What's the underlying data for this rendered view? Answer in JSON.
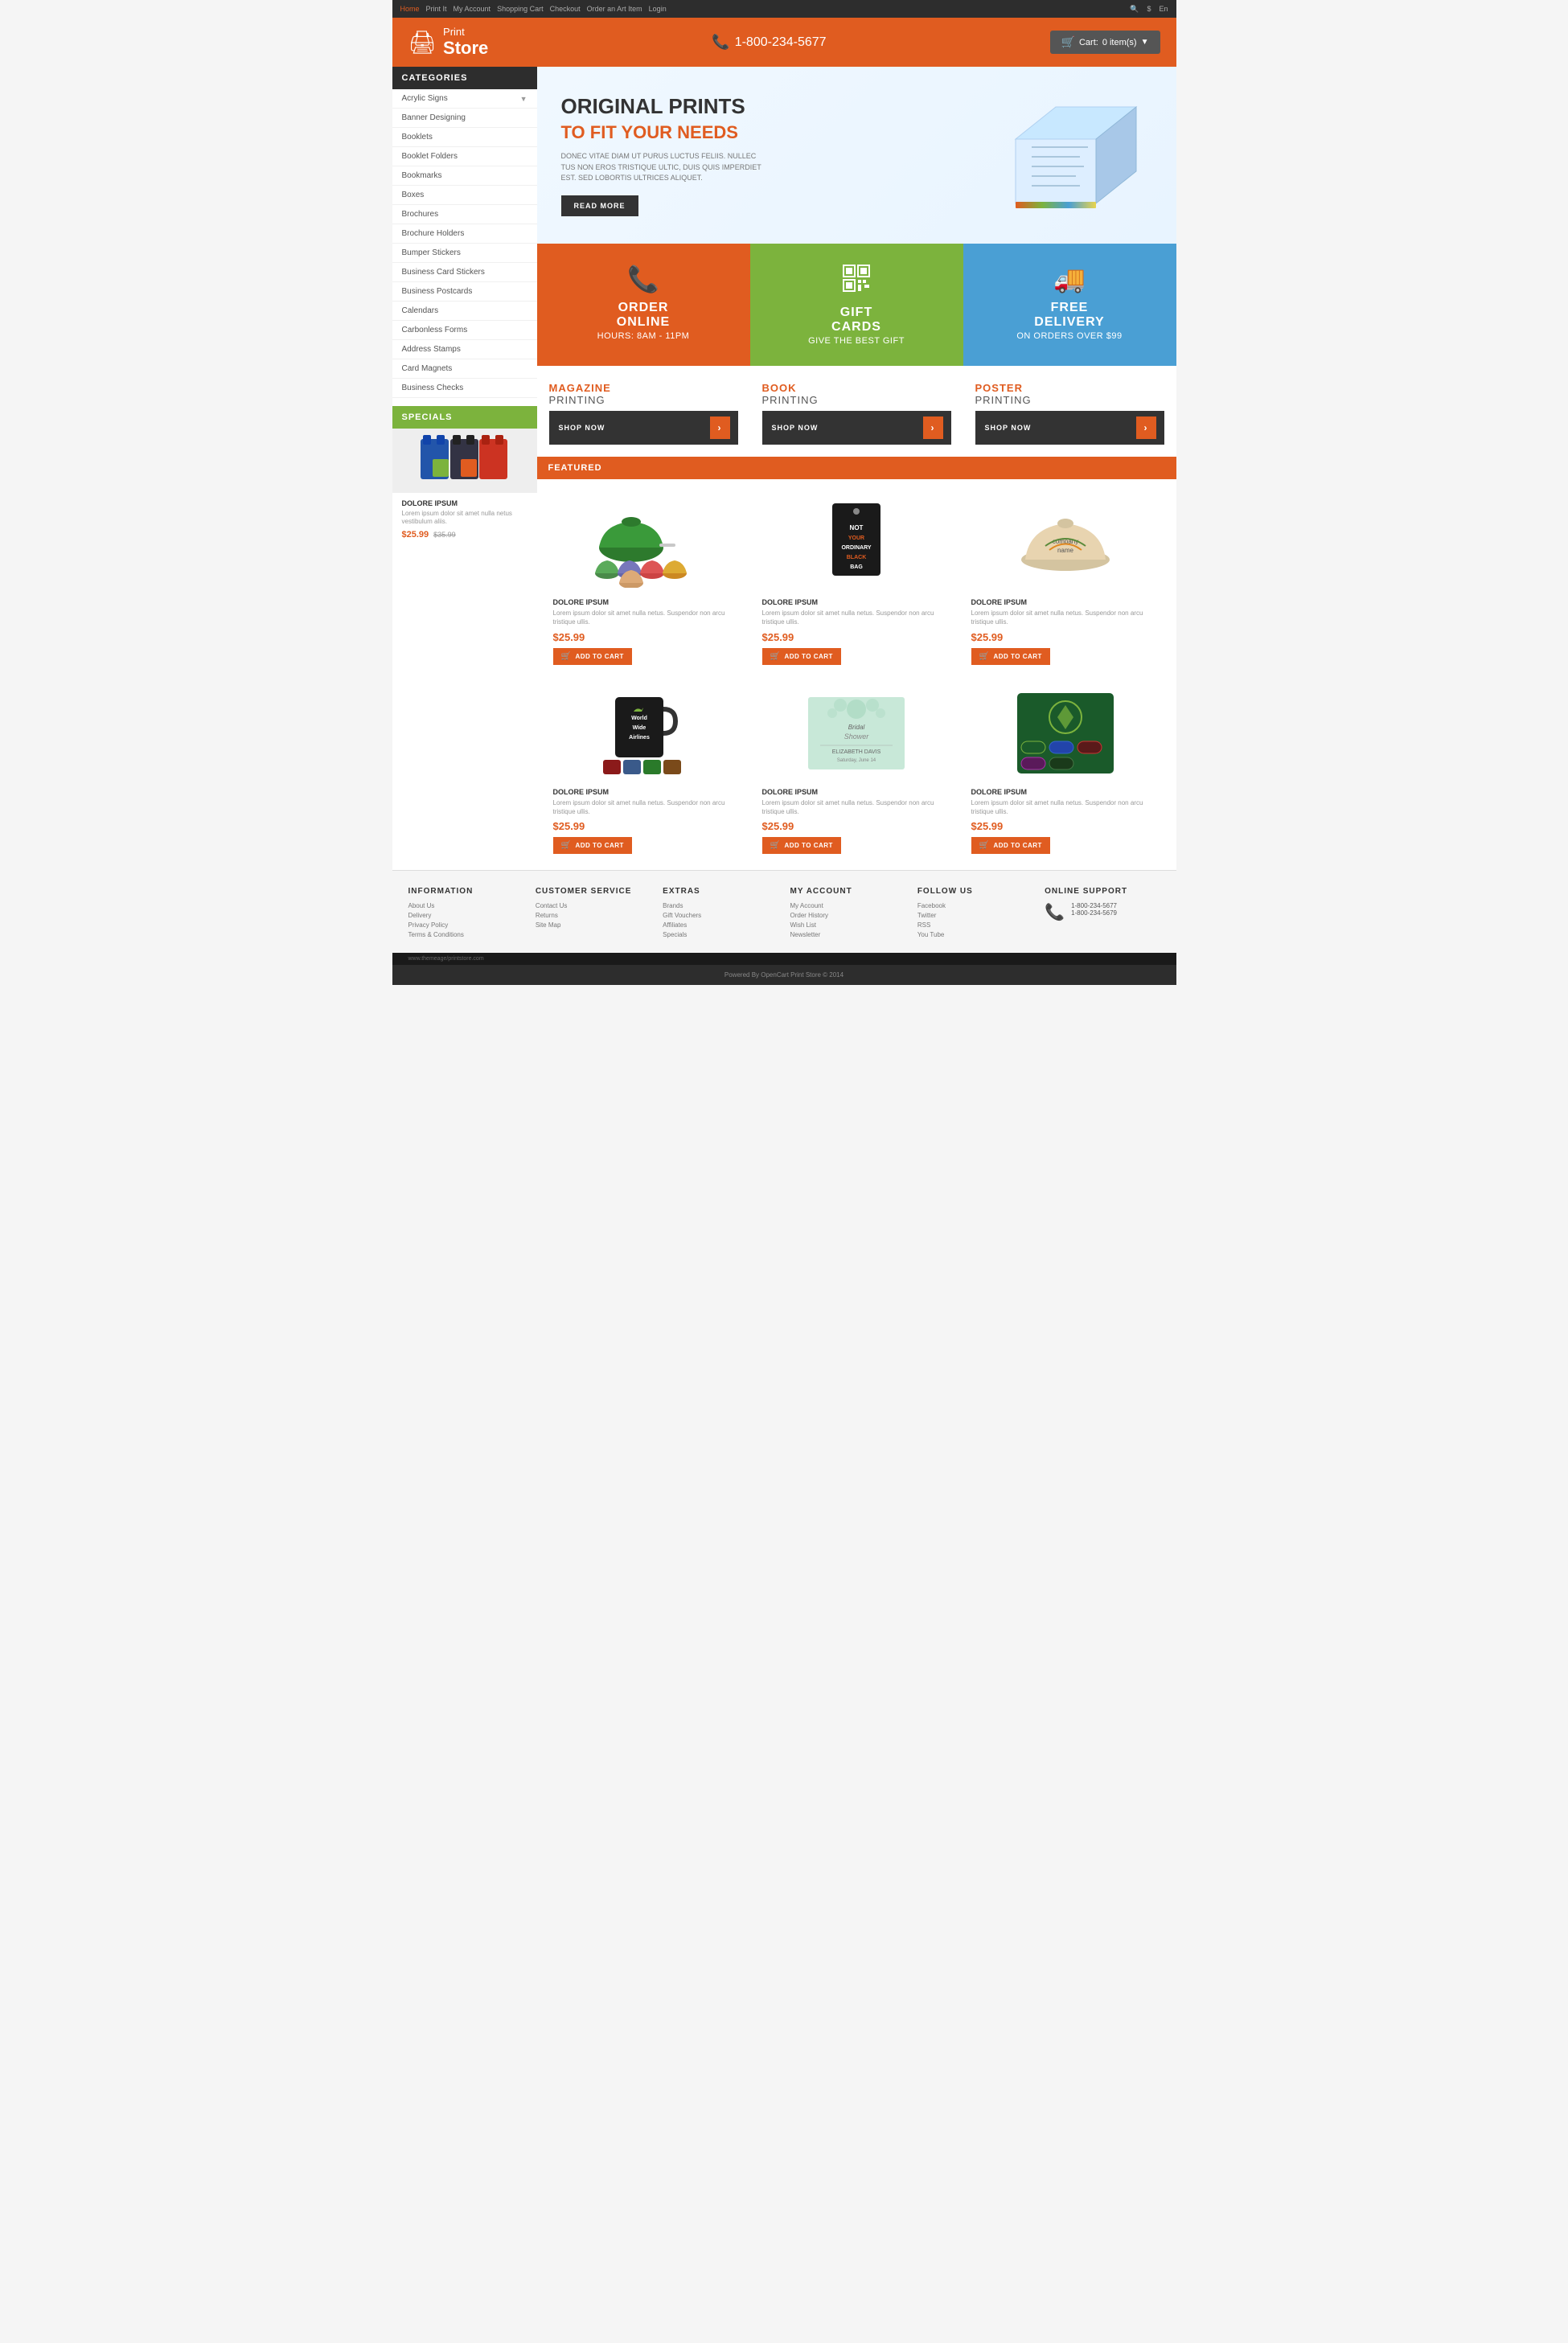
{
  "topnav": {
    "links": [
      "Home",
      "Print It",
      "My Account",
      "Shopping Cart",
      "Checkout",
      "Order an Art Item",
      "Login"
    ],
    "active_link": "Home",
    "search_label": "🔍",
    "currency": "$",
    "language": "En"
  },
  "header": {
    "logo_print": "Print",
    "logo_store": "Store",
    "phone": "1-800-234-5677",
    "cart_label": "Cart:"
  },
  "sidebar": {
    "categories_label": "CATEGORIES",
    "items": [
      {
        "label": "Acrylic Signs",
        "has_arrow": true
      },
      {
        "label": "Banner Designing",
        "has_arrow": false
      },
      {
        "label": "Booklets",
        "has_arrow": false
      },
      {
        "label": "Booklet Folders",
        "has_arrow": false
      },
      {
        "label": "Bookmarks",
        "has_arrow": false
      },
      {
        "label": "Boxes",
        "has_arrow": false
      },
      {
        "label": "Brochures",
        "has_arrow": false
      },
      {
        "label": "Brochure Holders",
        "has_arrow": false
      },
      {
        "label": "Bumper Stickers",
        "has_arrow": false
      },
      {
        "label": "Business Card Stickers",
        "has_arrow": false
      },
      {
        "label": "Business Postcards",
        "has_arrow": false
      },
      {
        "label": "Calendars",
        "has_arrow": false
      },
      {
        "label": "Carbonless Forms",
        "has_arrow": false
      },
      {
        "label": "Address Stamps",
        "has_arrow": false
      },
      {
        "label": "Card Magnets",
        "has_arrow": false
      },
      {
        "label": "Business Checks",
        "has_arrow": false
      }
    ],
    "specials_label": "SPECIALS",
    "specials_product": {
      "title": "DOLORE IPSUM",
      "desc": "Lorem ipsum dolor sit amet nulla netus vestibulum aliis.",
      "price_new": "$25.99",
      "price_old": "$35.99"
    }
  },
  "hero": {
    "title": "ORIGINAL PRINTS",
    "subtitle": "TO FIT YOUR NEEDS",
    "description": "DONEC VITAE DIAM UT PURUS LUCTUS FELIIS. NULLEC TUS NON EROS TRISTIQUE ULTIC, DUIS QUIS IMPERDIET EST. SED LOBORTIS ULTRICES ALIQUET.",
    "button_label": "READ MORE"
  },
  "features": [
    {
      "icon": "📞",
      "title": "ORDER\nONLINE",
      "subtitle": "HOURS: 8AM - 11PM",
      "color": "orange"
    },
    {
      "icon": "▦",
      "title": "GIFT\nCARDS",
      "subtitle": "GIVE THE BEST GIFT",
      "color": "green"
    },
    {
      "icon": "🚚",
      "title": "FREE\nDELIVERY",
      "subtitle": "ON ORDERS OVER $99",
      "color": "blue"
    }
  ],
  "printing_sections": [
    {
      "type": "MAGAZINE",
      "label": "PRINTING",
      "button": "SHOP NOW"
    },
    {
      "type": "BOOK",
      "label": "PRINTING",
      "button": "SHOP NOW"
    },
    {
      "type": "POSTER",
      "label": "PRINTING",
      "button": "SHOP NOW"
    }
  ],
  "featured": {
    "header_label": "FEATURED",
    "products": [
      {
        "id": 1,
        "title": "DOLORE IPSUM",
        "desc": "Lorem ipsum dolor sit amet nulla netus. Suspendor non arcu tristique ullis.",
        "price": "$25.99",
        "button": "ADD TO CART",
        "img_type": "caps"
      },
      {
        "id": 2,
        "title": "DOLORE IPSUM",
        "desc": "Lorem ipsum dolor sit amet nulla netus. Suspendor non arcu tristique ullis.",
        "price": "$25.99",
        "button": "ADD TO CART",
        "img_type": "tag"
      },
      {
        "id": 3,
        "title": "DOLORE IPSUM",
        "desc": "Lorem ipsum dolor sit amet nulla netus. Suspendor non arcu tristique ullis.",
        "price": "$25.99",
        "button": "ADD TO CART",
        "img_type": "hat"
      },
      {
        "id": 4,
        "title": "DOLORE IPSUM",
        "desc": "Lorem ipsum dolor sit amet nulla netus. Suspendor non arcu tristique ullis.",
        "price": "$25.99",
        "button": "ADD TO CART",
        "img_type": "mug"
      },
      {
        "id": 5,
        "title": "DOLORE IPSUM",
        "desc": "Lorem ipsum dolor sit amet nulla netus. Suspendor non arcu tristique ullis.",
        "price": "$25.99",
        "button": "ADD TO CART",
        "img_type": "invite"
      },
      {
        "id": 6,
        "title": "DOLORE IPSUM",
        "desc": "Lorem ipsum dolor sit amet nulla netus. Suspendor non arcu tristique ullis.",
        "price": "$25.99",
        "button": "ADD TO CART",
        "img_type": "bands"
      }
    ]
  },
  "footer": {
    "columns": [
      {
        "title": "INFORMATION",
        "links": [
          "About Us",
          "Delivery",
          "Privacy Policy",
          "Terms & Conditions"
        ]
      },
      {
        "title": "CUSTOMER SERVICE",
        "links": [
          "Contact Us",
          "Returns",
          "Site Map"
        ]
      },
      {
        "title": "EXTRAS",
        "links": [
          "Brands",
          "Gift Vouchers",
          "Affiliates",
          "Specials"
        ]
      },
      {
        "title": "MY ACCOUNT",
        "links": [
          "My Account",
          "Order History",
          "Wish List",
          "Newsletter"
        ]
      },
      {
        "title": "FOLLOW US",
        "links": [
          "Facebook",
          "Twitter",
          "RSS",
          "You Tube"
        ]
      },
      {
        "title": "ONLINE SUPPORT",
        "phone1": "1-800-234-5677",
        "phone2": "1-800-234-5679"
      }
    ],
    "bottom_text": "Powered By OpenCart Print Store © 2014",
    "website": "www.themeage/printstore.com"
  }
}
